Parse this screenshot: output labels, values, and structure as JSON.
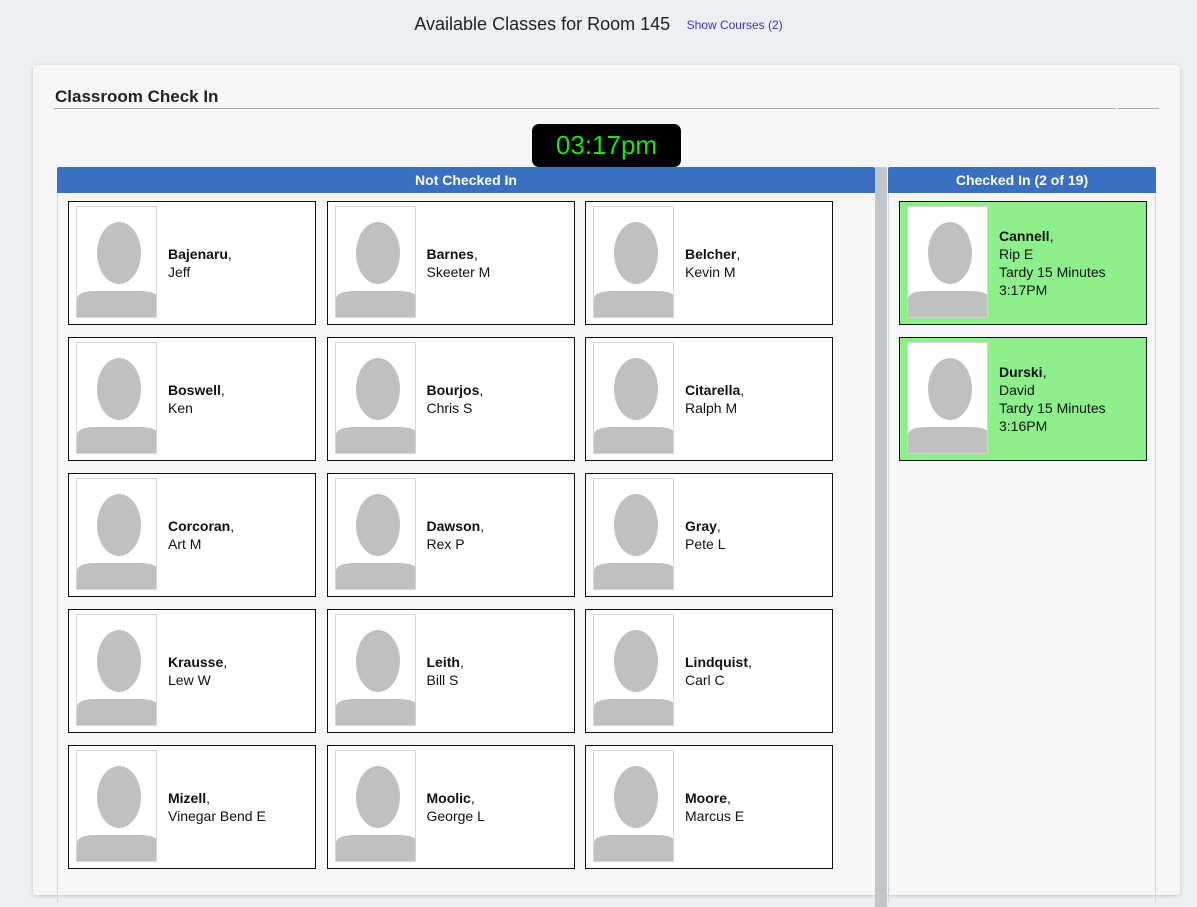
{
  "header": {
    "title": "Available Classes for Room 145",
    "show_courses": "Show Courses (2)"
  },
  "panel": {
    "heading": "Classroom Check In",
    "clock": "03:17pm"
  },
  "not_checked_in": {
    "title": "Not Checked In",
    "students": [
      {
        "last": "Bajenaru",
        "first": "Jeff"
      },
      {
        "last": "Barnes",
        "first": "Skeeter M"
      },
      {
        "last": "Belcher",
        "first": "Kevin M"
      },
      {
        "last": "Boswell",
        "first": "Ken"
      },
      {
        "last": "Bourjos",
        "first": "Chris S"
      },
      {
        "last": "Citarella",
        "first": "Ralph M"
      },
      {
        "last": "Corcoran",
        "first": "Art M"
      },
      {
        "last": "Dawson",
        "first": "Rex P"
      },
      {
        "last": "Gray",
        "first": "Pete L"
      },
      {
        "last": "Krausse",
        "first": "Lew W"
      },
      {
        "last": "Leith",
        "first": "Bill S"
      },
      {
        "last": "Lindquist",
        "first": "Carl C"
      },
      {
        "last": "Mizell",
        "first": "Vinegar Bend E"
      },
      {
        "last": "Moolic",
        "first": "George L"
      },
      {
        "last": "Moore",
        "first": "Marcus E"
      }
    ]
  },
  "checked_in": {
    "title": "Checked In (2 of 19)",
    "students": [
      {
        "last": "Cannell",
        "first": "Rip E",
        "status": "Tardy 15 Minutes",
        "time": "3:17PM"
      },
      {
        "last": "Durski",
        "first": "David",
        "status": "Tardy 15 Minutes",
        "time": "3:16PM"
      }
    ]
  },
  "colors": {
    "header_blue": "#3b6fc0",
    "checked_green": "#8cef8c",
    "clock_green": "#1fe01f",
    "link": "#3a34c8"
  },
  "icons": {
    "avatar": "person-silhouette-icon"
  }
}
